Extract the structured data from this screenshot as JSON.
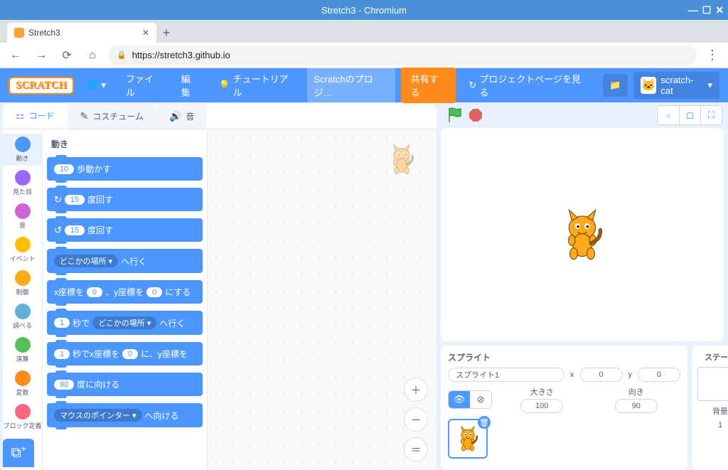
{
  "window": {
    "title": "Stretch3 - Chromium"
  },
  "browser": {
    "tab_title": "Stretch3",
    "url": "https://stretch3.github.io"
  },
  "menu": {
    "file": "ファイル",
    "edit": "編集",
    "tutorials": "チュートリアル",
    "project_title": "Scratchのプロジ…",
    "share": "共有する",
    "see_project_page": "プロジェクトページを見る",
    "username": "scratch-cat"
  },
  "tabs": {
    "code": "コード",
    "costumes": "コスチューム",
    "sounds": "音"
  },
  "categories": [
    {
      "label": "動き",
      "color": "#4c97ff"
    },
    {
      "label": "見た目",
      "color": "#9966ff"
    },
    {
      "label": "音",
      "color": "#cf63cf"
    },
    {
      "label": "イベント",
      "color": "#ffbf00"
    },
    {
      "label": "制御",
      "color": "#ffab19"
    },
    {
      "label": "調べる",
      "color": "#5cb1d6"
    },
    {
      "label": "演算",
      "color": "#59c059"
    },
    {
      "label": "変数",
      "color": "#ff8c1a"
    },
    {
      "label": "ブロック定義",
      "color": "#ff6680"
    }
  ],
  "palette": {
    "heading": "動き",
    "blocks": {
      "move_steps": {
        "val": "10",
        "suffix": "歩動かす"
      },
      "turn_cw": {
        "val": "15",
        "suffix": "度回す"
      },
      "turn_ccw": {
        "val": "15",
        "suffix": "度回す"
      },
      "goto": {
        "target": "どこかの場所",
        "suffix": "へ行く"
      },
      "goto_xy": {
        "p1": "x座標を",
        "x": "0",
        "p2": "、y座標を",
        "y": "0",
        "p3": "にする"
      },
      "glide_to": {
        "secs": "1",
        "p1": "秒で",
        "target": "どこかの場所",
        "suffix": "へ行く"
      },
      "glide_xy": {
        "secs": "1",
        "p1": "秒でx座標を",
        "x": "0",
        "p2": "に、y座標を"
      },
      "point_dir": {
        "val": "90",
        "suffix": "度に向ける"
      },
      "point_towards": {
        "target": "マウスのポインター",
        "suffix": "へ向ける"
      }
    }
  },
  "sprite_panel": {
    "title": "スプライト",
    "name": "スプライト1",
    "x_label": "x",
    "x": "0",
    "y_label": "y",
    "y": "0",
    "size_label": "大きさ",
    "size": "100",
    "dir_label": "向き",
    "dir": "90"
  },
  "stage_panel": {
    "title": "ステージ",
    "backdrops_label": "背景",
    "backdrops": "1"
  }
}
